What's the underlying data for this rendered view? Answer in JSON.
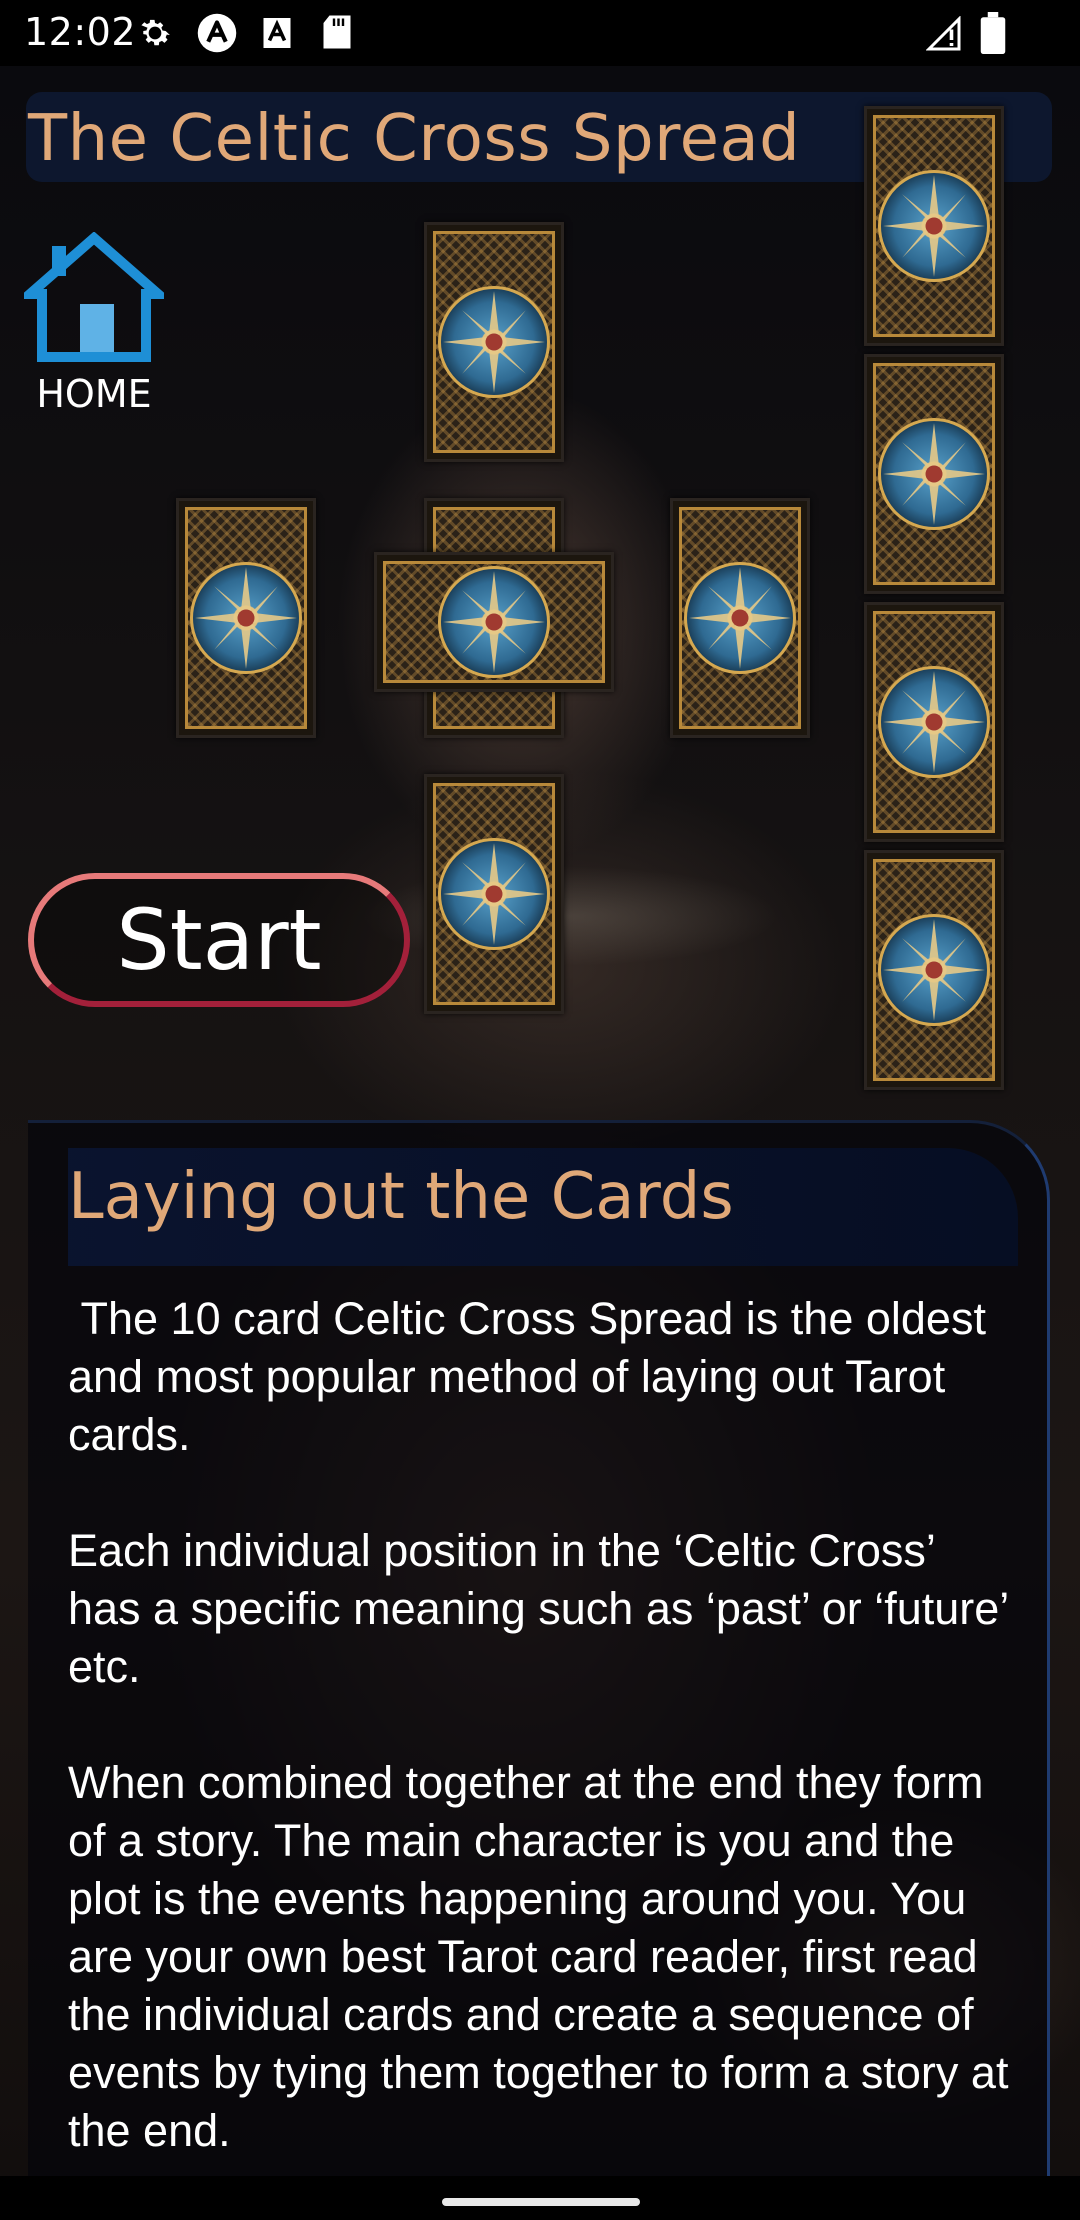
{
  "status_bar": {
    "time": "12:02",
    "icons": [
      "gear-icon",
      "a-app-icon",
      "a-box-icon",
      "sd-card-icon",
      "signal-icon",
      "battery-icon"
    ]
  },
  "title": "The Celtic Cross Spread",
  "home": {
    "label": "HOME",
    "icon": "house-icon"
  },
  "start_button": {
    "label": "Start"
  },
  "panel": {
    "heading": "Laying out the Cards",
    "body": " The 10 card Celtic Cross Spread is the oldest and most popular method of laying out Tarot cards.\n\nEach individual position in the ‘Celtic Cross’ has a specific meaning such as ‘past’ or ‘future’ etc.\n\nWhen combined together at the end they form of a story. The main character is you and the plot is the events happening around you. You are your own best Tarot card reader, first read the individual cards and create a sequence of events by tying them together to form a story at the end."
  },
  "colors": {
    "title_text": "#e0a878",
    "title_bar": "#0e1a34",
    "home_icon": "#1e8fd6",
    "start_border": "#a3203a"
  }
}
